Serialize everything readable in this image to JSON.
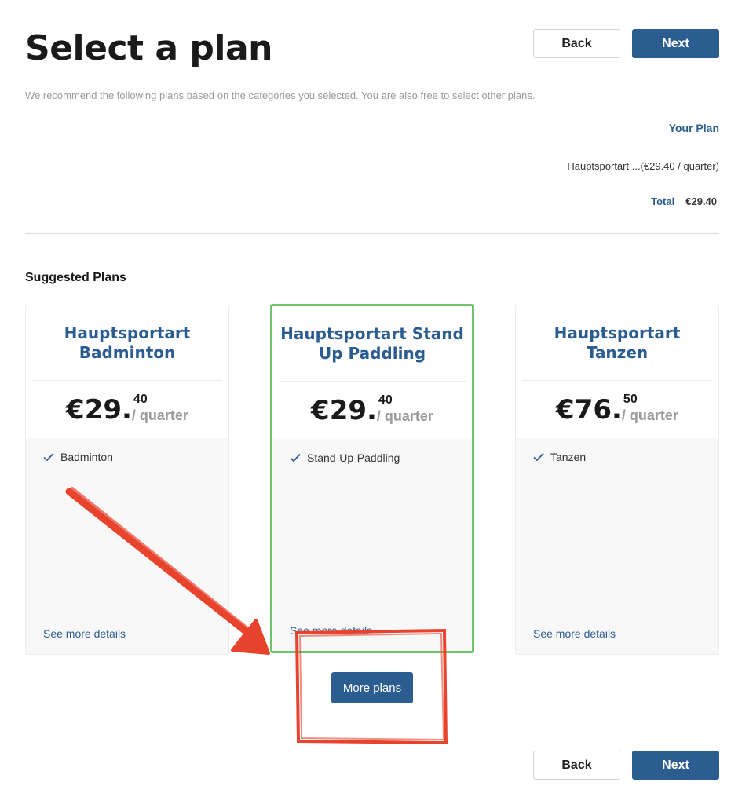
{
  "header": {
    "title": "Select a plan",
    "back_label": "Back",
    "next_label": "Next",
    "subtitle": "We recommend the following plans based on the categories you selected. You are also free to select other plans."
  },
  "summary": {
    "your_plan_label": "Your Plan",
    "plan_line": "Hauptsportart ...(€29.40 / quarter)",
    "total_label": "Total",
    "total_value": "€29.40"
  },
  "suggested": {
    "section_title": "Suggested Plans",
    "plans": [
      {
        "name": "Hauptsportart Badminton",
        "price_main": "€29.",
        "price_cents": "40",
        "period": "/ quarter",
        "feature": "Badminton",
        "details": "See more details",
        "selected": false
      },
      {
        "name": "Hauptsportart Stand Up Paddling",
        "price_main": "€29.",
        "price_cents": "40",
        "period": "/ quarter",
        "feature": "Stand-Up-Paddling",
        "details": "See more details",
        "selected": true
      },
      {
        "name": "Hauptsportart Tanzen",
        "price_main": "€76.",
        "price_cents": "50",
        "period": "/ quarter",
        "feature": "Tanzen",
        "details": "See more details",
        "selected": false
      }
    ],
    "more_plans_label": "More plans"
  },
  "footer": {
    "back_label": "Back",
    "next_label": "Next"
  },
  "colors": {
    "primary": "#2c5d91",
    "selected_border": "#6cc46f",
    "annotation": "#e8432d"
  }
}
